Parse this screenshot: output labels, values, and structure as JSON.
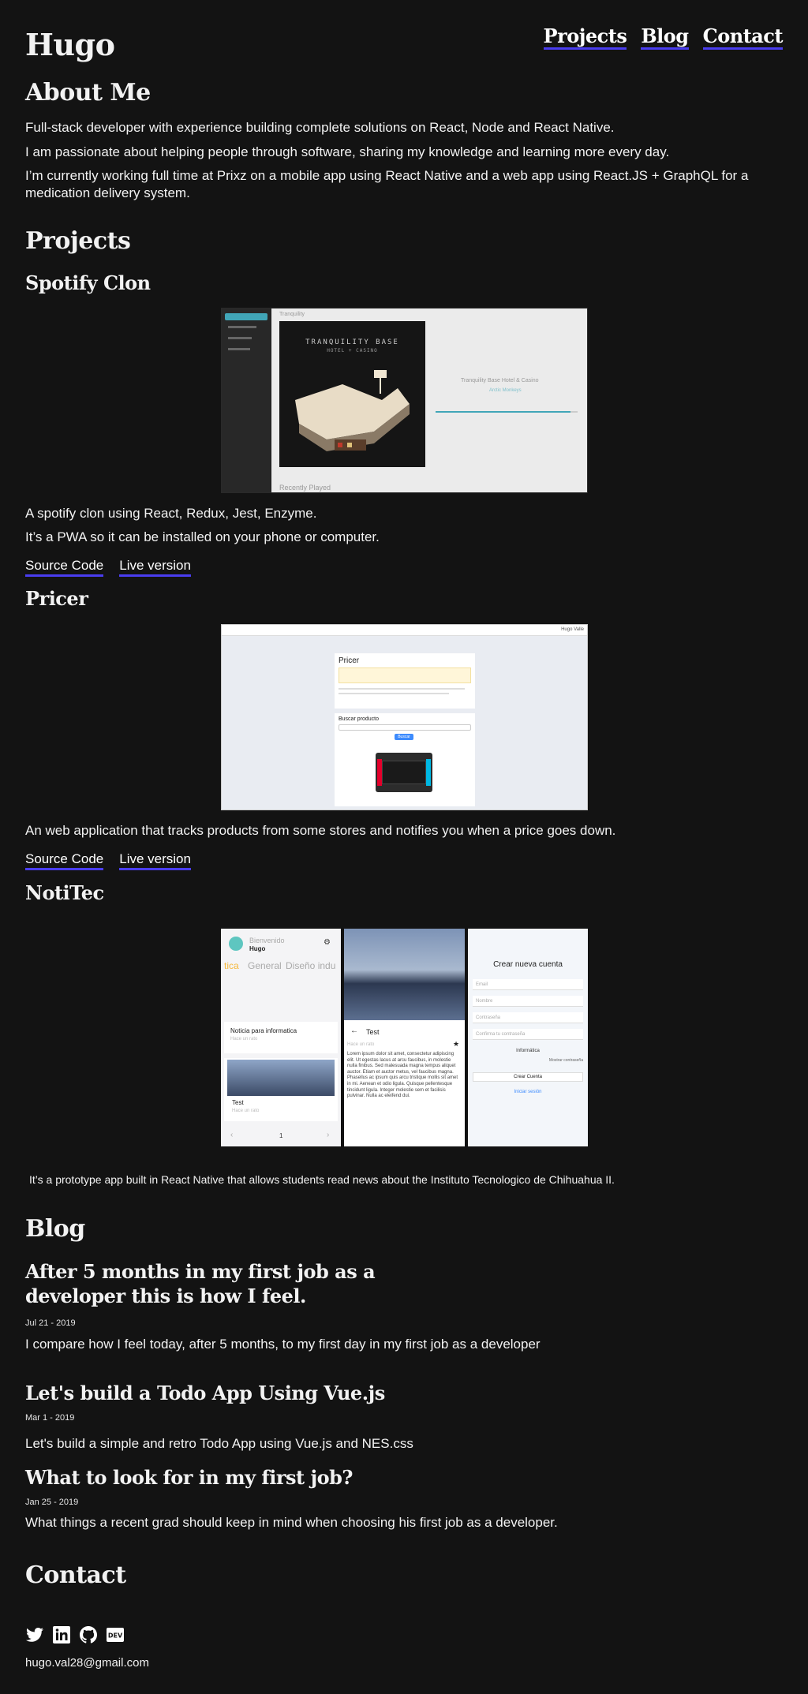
{
  "header": {
    "site_name": "Hugo",
    "nav": [
      "Projects",
      "Blog",
      "Contact"
    ]
  },
  "about": {
    "heading": "About Me",
    "paragraphs": [
      "Full-stack developer with experience building complete solutions on React, Node and React Native.",
      "I am passionate about helping people through software, sharing my knowledge and learning more every day.",
      "I’m currently working full time at Prixz on a mobile app using React Native and a web app using React.JS + GraphQL for a medication delivery system."
    ]
  },
  "projects": {
    "heading": "Projects",
    "items": [
      {
        "title": "Spotify Clon",
        "descriptions": [
          "A spotify clon using React, Redux, Jest, Enzyme.",
          "It’s a PWA so it can be installed on your phone or computer."
        ],
        "links": [
          "Source Code",
          "Live version"
        ],
        "screenshot": {
          "breadcrumb": "Tranquility",
          "album_line1": "TRANQUILITY BASE",
          "album_line2": "HOTEL + CASINO",
          "track_title": "Tranquility Base Hotel & Casino",
          "track_artist": "Arctic Monkeys",
          "footer": "Recently Played"
        }
      },
      {
        "title": "Pricer",
        "descriptions": [
          "An web application that tracks products from some stores and notifies you when a price goes down."
        ],
        "links": [
          "Source Code",
          "Live version"
        ],
        "screenshot": {
          "card_title": "Pricer",
          "search_title": "Buscar producto",
          "search_button": "Buscar",
          "user": "Hugo Valle"
        }
      },
      {
        "title": "NotiTec",
        "descriptions": [
          "It’s a prototype app built in React Native that allows students read news about the Instituto Tecnologico de Chihuahua II."
        ],
        "links": [],
        "screenshot": {
          "welcome": "Bienvenido",
          "user": "Hugo",
          "tabs": [
            "tica",
            "General",
            "Diseño indu"
          ],
          "news_title": "Noticia para informatica",
          "news_sub": "Hace un rato",
          "card_title": "Test",
          "page": "1",
          "article_title": "Test",
          "article_body": "Lorem ipsum dolor sit amet, consectetur adipiscing elit. Ut egestas lacus at arcu faucibus, in molestie nulla finibus. Sed malesuada magna tempus aliquet auctor. Etiam et auctor metus, vel faucibus magna. Phasellus ac ipsum quis arcu tristique mollis sit amet in mi. Aenean et odio ligula. Quisque pellentesque tincidunt ligula. Integer molestie sem et facilisis pulvinar. Nulla ac eleifend dui.",
          "signup_title": "Crear nueva cuenta",
          "fields": [
            "Email",
            "Nombre",
            "Contraseña",
            "Confirma tu contraseña"
          ],
          "career": "Informática",
          "show_password": "Mostrar contraseña",
          "create_button": "Crear Cuenta",
          "login_link": "Iniciar sesión"
        }
      }
    ]
  },
  "blog": {
    "heading": "Blog",
    "posts": [
      {
        "title": "After 5 months in my first job as a developer this is how I feel.",
        "date": "Jul 21 - 2019",
        "summary": "I compare how I feel today, after 5 months, to my first day in my first job as a developer"
      },
      {
        "title": "Let's build a Todo App Using Vue.js",
        "date": "Mar 1 - 2019",
        "summary": "Let's build a simple and retro Todo App using Vue.js and NES.css"
      },
      {
        "title": "What to look for in my first job?",
        "date": "Jan 25 - 2019",
        "summary": "What things a recent grad should keep in mind when choosing his first job as a developer."
      }
    ]
  },
  "contact": {
    "heading": "Contact",
    "social_icons": [
      "twitter-icon",
      "linkedin-icon",
      "github-icon",
      "dev-icon"
    ],
    "email": "hugo.val28@gmail.com"
  },
  "colors": {
    "background": "#131313",
    "link_underline": "#4a3df0"
  }
}
